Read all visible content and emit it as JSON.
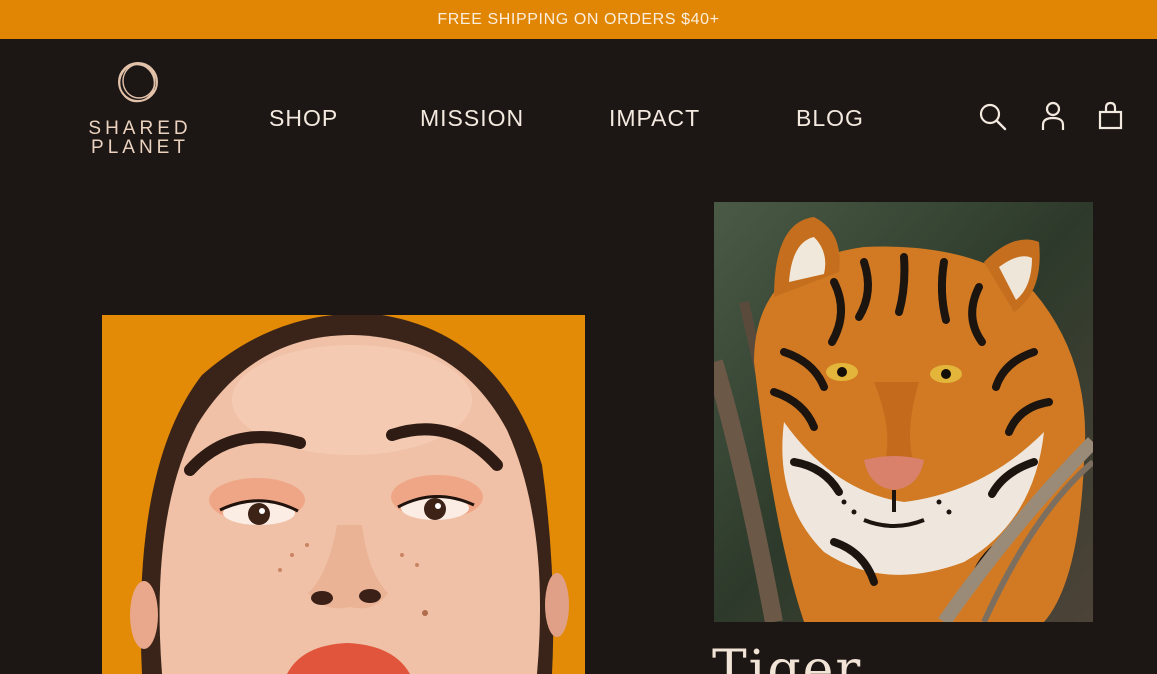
{
  "promo": {
    "text": "FREE SHIPPING ON ORDERS $40+"
  },
  "brand": {
    "line1": "SHARED",
    "line2": "PLANET"
  },
  "nav": {
    "items": [
      {
        "label": "SHOP"
      },
      {
        "label": "MISSION"
      },
      {
        "label": "IMPACT"
      },
      {
        "label": "BLOG"
      }
    ]
  },
  "header_icons": [
    "search-icon",
    "account-icon",
    "cart-icon"
  ],
  "feature": {
    "title": "Tiger"
  },
  "colors": {
    "accent": "#e08604",
    "background": "#1c1715",
    "text": "#f3e9df",
    "logo": "#ecd3bf"
  }
}
